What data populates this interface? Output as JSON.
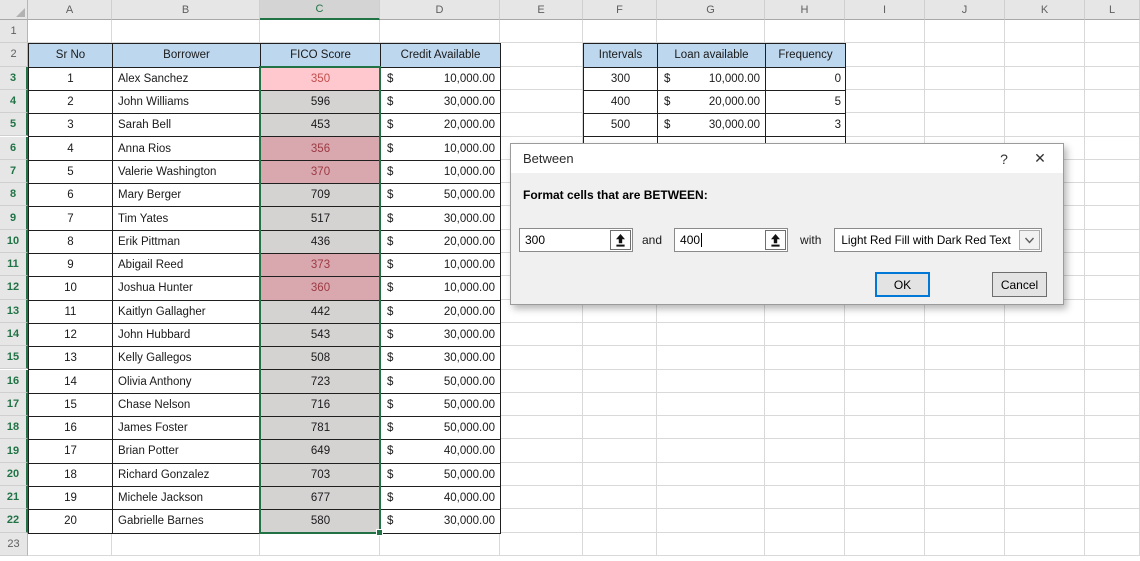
{
  "sheet": {
    "column_letters": [
      "A",
      "B",
      "C",
      "D",
      "E",
      "F",
      "G",
      "H",
      "I",
      "J",
      "K",
      "L"
    ],
    "row_count": 23,
    "selected_column": "C",
    "selected_rows_from": 3,
    "selected_rows_to": 22
  },
  "borrowers_table": {
    "headers": [
      "Sr No",
      "Borrower",
      "FICO Score",
      "Credit Available"
    ],
    "currency_symbol": "$",
    "rows": [
      {
        "sr_no": "1",
        "borrower": "Alex Sanchez",
        "fico_score": "350",
        "credit_available": "10,000.00",
        "fico_state": "active"
      },
      {
        "sr_no": "2",
        "borrower": "John Williams",
        "fico_score": "596",
        "credit_available": "30,000.00",
        "fico_state": "selected"
      },
      {
        "sr_no": "3",
        "borrower": "Sarah Bell",
        "fico_score": "453",
        "credit_available": "20,000.00",
        "fico_state": "selected"
      },
      {
        "sr_no": "4",
        "borrower": "Anna Rios",
        "fico_score": "356",
        "credit_available": "10,000.00",
        "fico_state": "match"
      },
      {
        "sr_no": "5",
        "borrower": "Valerie Washington",
        "fico_score": "370",
        "credit_available": "10,000.00",
        "fico_state": "match"
      },
      {
        "sr_no": "6",
        "borrower": "Mary Berger",
        "fico_score": "709",
        "credit_available": "50,000.00",
        "fico_state": "selected"
      },
      {
        "sr_no": "7",
        "borrower": "Tim Yates",
        "fico_score": "517",
        "credit_available": "30,000.00",
        "fico_state": "selected"
      },
      {
        "sr_no": "8",
        "borrower": "Erik Pittman",
        "fico_score": "436",
        "credit_available": "20,000.00",
        "fico_state": "selected"
      },
      {
        "sr_no": "9",
        "borrower": "Abigail Reed",
        "fico_score": "373",
        "credit_available": "10,000.00",
        "fico_state": "match"
      },
      {
        "sr_no": "10",
        "borrower": "Joshua Hunter",
        "fico_score": "360",
        "credit_available": "10,000.00",
        "fico_state": "match"
      },
      {
        "sr_no": "11",
        "borrower": "Kaitlyn Gallagher",
        "fico_score": "442",
        "credit_available": "20,000.00",
        "fico_state": "selected"
      },
      {
        "sr_no": "12",
        "borrower": "John Hubbard",
        "fico_score": "543",
        "credit_available": "30,000.00",
        "fico_state": "selected"
      },
      {
        "sr_no": "13",
        "borrower": "Kelly Gallegos",
        "fico_score": "508",
        "credit_available": "30,000.00",
        "fico_state": "selected"
      },
      {
        "sr_no": "14",
        "borrower": "Olivia Anthony",
        "fico_score": "723",
        "credit_available": "50,000.00",
        "fico_state": "selected"
      },
      {
        "sr_no": "15",
        "borrower": "Chase Nelson",
        "fico_score": "716",
        "credit_available": "50,000.00",
        "fico_state": "selected"
      },
      {
        "sr_no": "16",
        "borrower": "James Foster",
        "fico_score": "781",
        "credit_available": "50,000.00",
        "fico_state": "selected"
      },
      {
        "sr_no": "17",
        "borrower": "Brian Potter",
        "fico_score": "649",
        "credit_available": "40,000.00",
        "fico_state": "selected"
      },
      {
        "sr_no": "18",
        "borrower": "Richard Gonzalez",
        "fico_score": "703",
        "credit_available": "50,000.00",
        "fico_state": "selected"
      },
      {
        "sr_no": "19",
        "borrower": "Michele Jackson",
        "fico_score": "677",
        "credit_available": "40,000.00",
        "fico_state": "selected"
      },
      {
        "sr_no": "20",
        "borrower": "Gabrielle Barnes",
        "fico_score": "580",
        "credit_available": "30,000.00",
        "fico_state": "selected"
      }
    ]
  },
  "intervals_table": {
    "headers": [
      "Intervals",
      "Loan available",
      "Frequency"
    ],
    "currency_symbol": "$",
    "rows": [
      {
        "interval": "300",
        "loan_available": "10,000.00",
        "frequency": "0"
      },
      {
        "interval": "400",
        "loan_available": "20,000.00",
        "frequency": "5"
      },
      {
        "interval": "500",
        "loan_available": "30,000.00",
        "frequency": "3"
      },
      {
        "interval": "",
        "loan_available": "",
        "frequency": ""
      }
    ]
  },
  "dialog": {
    "title": "Between",
    "help_label": "?",
    "close_label": "✕",
    "instruction": "Format cells that are BETWEEN:",
    "min_value": "300",
    "max_value": "400",
    "and_label": "and",
    "with_label": "with",
    "format_style": "Light Red Fill with Dark Red Text",
    "ok_label": "OK",
    "cancel_label": "Cancel"
  },
  "colors": {
    "selection_green": "#217346",
    "header_fill_blue": "#BDD7EE",
    "active_cell_fill": "#FFC7CE",
    "active_cell_text": "#C0504D",
    "match_cell_fill": "#D9A7AE",
    "match_cell_text": "#9C3A42",
    "selected_cell_gray": "#D5D2D2",
    "gridline": "#D9D9D9",
    "table_border": "#1F1F1F",
    "header_bg": "#E6E6E6",
    "header_text": "#5F5F5F",
    "ok_focus_border": "#0078D7"
  }
}
